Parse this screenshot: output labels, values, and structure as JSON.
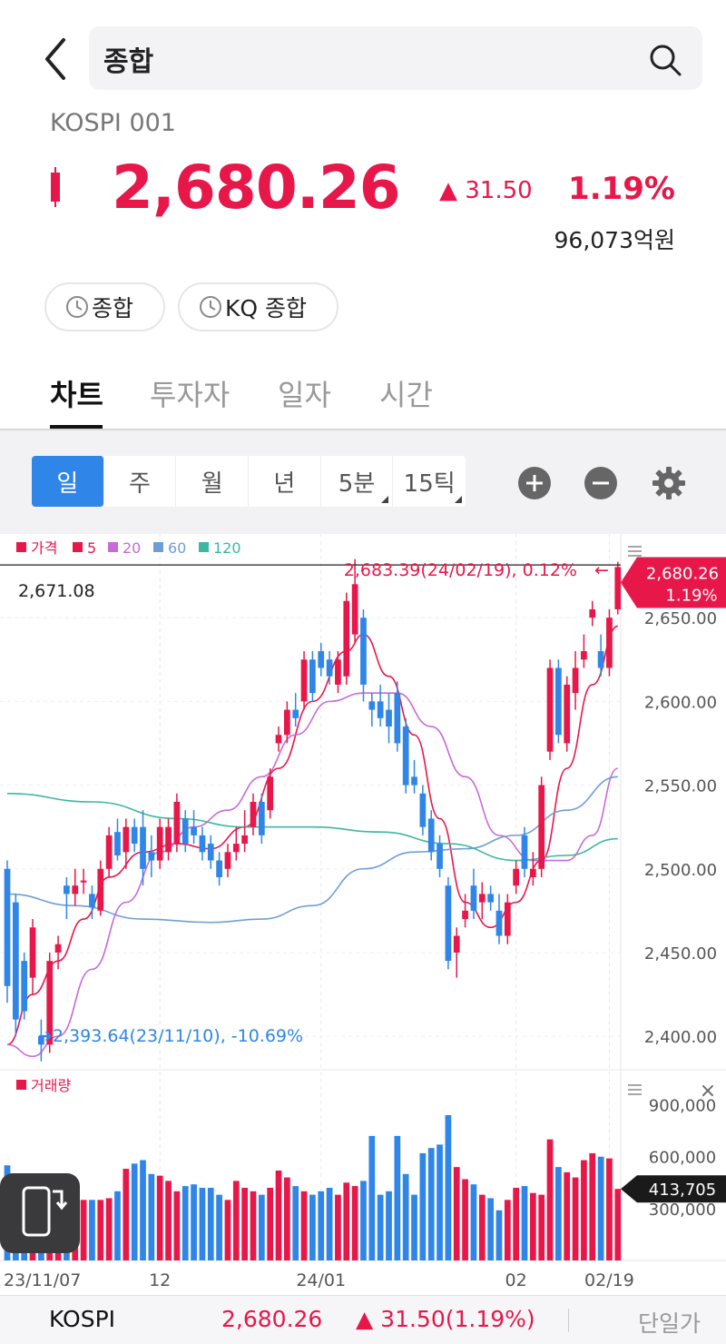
{
  "search": {
    "query": "종합"
  },
  "quote": {
    "ticker": "KOSPI 001",
    "price": "2,680.26",
    "change_abs": "▲ 31.50",
    "change_pct": "1.19%",
    "turnover": "96,073억원"
  },
  "chips": [
    {
      "label": "종합"
    },
    {
      "label": "KQ 종합"
    }
  ],
  "tabs": [
    {
      "label": "차트",
      "active": true
    },
    {
      "label": "투자자",
      "active": false
    },
    {
      "label": "일자",
      "active": false
    },
    {
      "label": "시간",
      "active": false
    }
  ],
  "periods": [
    {
      "label": "일",
      "active": true
    },
    {
      "label": "주",
      "active": false
    },
    {
      "label": "월",
      "active": false
    },
    {
      "label": "년",
      "active": false
    },
    {
      "label": "5분",
      "active": false
    },
    {
      "label": "15틱",
      "active": false
    }
  ],
  "colors": {
    "up": "#e8174a",
    "down": "#2f86e8",
    "ma5": "#e8174a",
    "ma20": "#c86ad8",
    "ma60": "#6f9ed6",
    "ma120": "#3db8a0"
  },
  "chart_data": {
    "type": "candlestick",
    "legend": [
      {
        "name": "가격",
        "color": "#e8174a"
      },
      {
        "name": "5",
        "color": "#e8174a"
      },
      {
        "name": "20",
        "color": "#c86ad8"
      },
      {
        "name": "60",
        "color": "#6f9ed6"
      },
      {
        "name": "120",
        "color": "#3db8a0"
      }
    ],
    "ylim": [
      2380,
      2700
    ],
    "y_ticks": [
      "2,650.00",
      "2,600.00",
      "2,550.00",
      "2,500.00",
      "2,450.00",
      "2,400.00"
    ],
    "y_tick_values": [
      2650,
      2600,
      2550,
      2500,
      2450,
      2400
    ],
    "x_labels": [
      {
        "label": "23/11/07",
        "index": 0
      },
      {
        "label": "12",
        "index": 18
      },
      {
        "label": "24/01",
        "index": 37
      },
      {
        "label": "02",
        "index": 60
      },
      {
        "label": "02/19",
        "index": 71
      }
    ],
    "crosshair_value": "2,671.08",
    "crosshair_price": 2681.5,
    "max_annotation": "2,683.39(24/02/19), 0.12%",
    "min_annotation": "➔2,393.64(23/11/10), -10.69%",
    "current_price_label": "2,680.26",
    "current_pct_label": "1.19%",
    "candles": [
      {
        "o": 2500,
        "h": 2505,
        "l": 2420,
        "c": 2430
      },
      {
        "o": 2480,
        "h": 2485,
        "l": 2400,
        "c": 2410
      },
      {
        "o": 2445,
        "h": 2450,
        "l": 2410,
        "c": 2415
      },
      {
        "o": 2435,
        "h": 2470,
        "l": 2425,
        "c": 2465
      },
      {
        "o": 2400,
        "h": 2410,
        "l": 2385,
        "c": 2395
      },
      {
        "o": 2395,
        "h": 2450,
        "l": 2390,
        "c": 2445
      },
      {
        "o": 2450,
        "h": 2460,
        "l": 2440,
        "c": 2455
      },
      {
        "o": 2490,
        "h": 2495,
        "l": 2470,
        "c": 2485
      },
      {
        "o": 2485,
        "h": 2500,
        "l": 2478,
        "c": 2490
      },
      {
        "o": 2492,
        "h": 2500,
        "l": 2485,
        "c": 2493
      },
      {
        "o": 2485,
        "h": 2490,
        "l": 2470,
        "c": 2477
      },
      {
        "o": 2475,
        "h": 2505,
        "l": 2472,
        "c": 2500
      },
      {
        "o": 2500,
        "h": 2525,
        "l": 2495,
        "c": 2520
      },
      {
        "o": 2522,
        "h": 2530,
        "l": 2505,
        "c": 2508
      },
      {
        "o": 2510,
        "h": 2530,
        "l": 2500,
        "c": 2525
      },
      {
        "o": 2525,
        "h": 2530,
        "l": 2510,
        "c": 2515
      },
      {
        "o": 2525,
        "h": 2535,
        "l": 2490,
        "c": 2500
      },
      {
        "o": 2510,
        "h": 2520,
        "l": 2495,
        "c": 2505
      },
      {
        "o": 2505,
        "h": 2530,
        "l": 2500,
        "c": 2525
      },
      {
        "o": 2510,
        "h": 2530,
        "l": 2505,
        "c": 2525
      },
      {
        "o": 2515,
        "h": 2545,
        "l": 2510,
        "c": 2540
      },
      {
        "o": 2530,
        "h": 2535,
        "l": 2510,
        "c": 2515
      },
      {
        "o": 2525,
        "h": 2535,
        "l": 2515,
        "c": 2520
      },
      {
        "o": 2520,
        "h": 2525,
        "l": 2505,
        "c": 2510
      },
      {
        "o": 2515,
        "h": 2520,
        "l": 2500,
        "c": 2505
      },
      {
        "o": 2505,
        "h": 2510,
        "l": 2490,
        "c": 2495
      },
      {
        "o": 2500,
        "h": 2515,
        "l": 2495,
        "c": 2510
      },
      {
        "o": 2510,
        "h": 2525,
        "l": 2505,
        "c": 2515
      },
      {
        "o": 2515,
        "h": 2535,
        "l": 2510,
        "c": 2520
      },
      {
        "o": 2525,
        "h": 2545,
        "l": 2520,
        "c": 2540
      },
      {
        "o": 2540,
        "h": 2545,
        "l": 2515,
        "c": 2520
      },
      {
        "o": 2535,
        "h": 2560,
        "l": 2530,
        "c": 2555
      },
      {
        "o": 2575,
        "h": 2585,
        "l": 2570,
        "c": 2580
      },
      {
        "o": 2580,
        "h": 2600,
        "l": 2575,
        "c": 2595
      },
      {
        "o": 2595,
        "h": 2605,
        "l": 2585,
        "c": 2590
      },
      {
        "o": 2600,
        "h": 2630,
        "l": 2595,
        "c": 2625
      },
      {
        "o": 2625,
        "h": 2630,
        "l": 2600,
        "c": 2605
      },
      {
        "o": 2630,
        "h": 2635,
        "l": 2615,
        "c": 2620
      },
      {
        "o": 2625,
        "h": 2630,
        "l": 2610,
        "c": 2615
      },
      {
        "o": 2610,
        "h": 2630,
        "l": 2605,
        "c": 2625
      },
      {
        "o": 2615,
        "h": 2665,
        "l": 2610,
        "c": 2660
      },
      {
        "o": 2640,
        "h": 2685,
        "l": 2635,
        "c": 2670
      },
      {
        "o": 2650,
        "h": 2655,
        "l": 2600,
        "c": 2610
      },
      {
        "o": 2600,
        "h": 2605,
        "l": 2585,
        "c": 2595
      },
      {
        "o": 2600,
        "h": 2610,
        "l": 2585,
        "c": 2590
      },
      {
        "o": 2595,
        "h": 2605,
        "l": 2575,
        "c": 2585
      },
      {
        "o": 2605,
        "h": 2612,
        "l": 2570,
        "c": 2575
      },
      {
        "o": 2585,
        "h": 2590,
        "l": 2545,
        "c": 2550
      },
      {
        "o": 2555,
        "h": 2565,
        "l": 2545,
        "c": 2550
      },
      {
        "o": 2545,
        "h": 2550,
        "l": 2520,
        "c": 2525
      },
      {
        "o": 2530,
        "h": 2535,
        "l": 2505,
        "c": 2510
      },
      {
        "o": 2515,
        "h": 2520,
        "l": 2495,
        "c": 2500
      },
      {
        "o": 2490,
        "h": 2495,
        "l": 2440,
        "c": 2445
      },
      {
        "o": 2450,
        "h": 2465,
        "l": 2435,
        "c": 2460
      },
      {
        "o": 2470,
        "h": 2485,
        "l": 2465,
        "c": 2475
      },
      {
        "o": 2490,
        "h": 2500,
        "l": 2470,
        "c": 2475
      },
      {
        "o": 2480,
        "h": 2492,
        "l": 2470,
        "c": 2485
      },
      {
        "o": 2485,
        "h": 2490,
        "l": 2475,
        "c": 2480
      },
      {
        "o": 2475,
        "h": 2485,
        "l": 2455,
        "c": 2460
      },
      {
        "o": 2460,
        "h": 2485,
        "l": 2455,
        "c": 2480
      },
      {
        "o": 2490,
        "h": 2505,
        "l": 2485,
        "c": 2500
      },
      {
        "o": 2520,
        "h": 2525,
        "l": 2495,
        "c": 2500
      },
      {
        "o": 2495,
        "h": 2510,
        "l": 2490,
        "c": 2500
      },
      {
        "o": 2500,
        "h": 2555,
        "l": 2495,
        "c": 2550
      },
      {
        "o": 2570,
        "h": 2625,
        "l": 2565,
        "c": 2620
      },
      {
        "o": 2620,
        "h": 2625,
        "l": 2575,
        "c": 2580
      },
      {
        "o": 2575,
        "h": 2615,
        "l": 2570,
        "c": 2610
      },
      {
        "o": 2605,
        "h": 2630,
        "l": 2595,
        "c": 2620
      },
      {
        "o": 2625,
        "h": 2640,
        "l": 2620,
        "c": 2630
      },
      {
        "o": 2650,
        "h": 2660,
        "l": 2645,
        "c": 2655
      },
      {
        "o": 2630,
        "h": 2640,
        "l": 2615,
        "c": 2620
      },
      {
        "o": 2620,
        "h": 2655,
        "l": 2615,
        "c": 2650
      },
      {
        "o": 2655,
        "h": 2683.39,
        "l": 2652,
        "c": 2680.26
      }
    ],
    "ma_anchors": {
      "ma5": [
        [
          0,
          2395
        ],
        [
          3,
          2425
        ],
        [
          6,
          2445
        ],
        [
          9,
          2470
        ],
        [
          12,
          2495
        ],
        [
          16,
          2510
        ],
        [
          20,
          2515
        ],
        [
          24,
          2512
        ],
        [
          28,
          2525
        ],
        [
          32,
          2560
        ],
        [
          36,
          2600
        ],
        [
          40,
          2630
        ],
        [
          42,
          2640
        ],
        [
          45,
          2615
        ],
        [
          48,
          2580
        ],
        [
          51,
          2530
        ],
        [
          54,
          2480
        ],
        [
          57,
          2465
        ],
        [
          60,
          2480
        ],
        [
          63,
          2505
        ],
        [
          66,
          2560
        ],
        [
          69,
          2610
        ],
        [
          72,
          2645
        ]
      ],
      "ma20": [
        [
          0,
          2395
        ],
        [
          3,
          2388
        ],
        [
          6,
          2400
        ],
        [
          10,
          2440
        ],
        [
          14,
          2480
        ],
        [
          18,
          2510
        ],
        [
          22,
          2525
        ],
        [
          26,
          2535
        ],
        [
          30,
          2555
        ],
        [
          34,
          2580
        ],
        [
          38,
          2600
        ],
        [
          42,
          2605
        ],
        [
          46,
          2605
        ],
        [
          50,
          2585
        ],
        [
          54,
          2555
        ],
        [
          58,
          2520
        ],
        [
          62,
          2505
        ],
        [
          66,
          2505
        ],
        [
          69,
          2520
        ],
        [
          72,
          2560
        ]
      ],
      "ma60": [
        [
          0,
          2485
        ],
        [
          8,
          2478
        ],
        [
          16,
          2470
        ],
        [
          24,
          2468
        ],
        [
          30,
          2470
        ],
        [
          36,
          2478
        ],
        [
          42,
          2500
        ],
        [
          48,
          2510
        ],
        [
          54,
          2512
        ],
        [
          60,
          2520
        ],
        [
          66,
          2535
        ],
        [
          72,
          2555
        ]
      ],
      "ma120": [
        [
          0,
          2545
        ],
        [
          10,
          2540
        ],
        [
          20,
          2530
        ],
        [
          28,
          2525
        ],
        [
          36,
          2525
        ],
        [
          44,
          2522
        ],
        [
          52,
          2515
        ],
        [
          60,
          2505
        ],
        [
          66,
          2508
        ],
        [
          72,
          2518
        ]
      ]
    },
    "volume": {
      "legend": "거래량",
      "ylim": [
        0,
        1050000
      ],
      "y_ticks": [
        "900,000",
        "600,000",
        "300,000"
      ],
      "y_tick_values": [
        900000,
        600000,
        300000
      ],
      "current_label": "413,705",
      "current_value": 413705,
      "values": [
        550000,
        470000,
        350000,
        360000,
        400000,
        380000,
        380000,
        370000,
        420000,
        350000,
        350000,
        350000,
        360000,
        400000,
        530000,
        560000,
        580000,
        500000,
        490000,
        460000,
        400000,
        430000,
        440000,
        420000,
        420000,
        380000,
        350000,
        460000,
        420000,
        400000,
        380000,
        420000,
        520000,
        480000,
        430000,
        400000,
        380000,
        400000,
        420000,
        380000,
        450000,
        430000,
        460000,
        720000,
        380000,
        400000,
        720000,
        500000,
        380000,
        620000,
        650000,
        670000,
        840000,
        540000,
        470000,
        440000,
        380000,
        360000,
        290000,
        350000,
        420000,
        430000,
        390000,
        380000,
        700000,
        540000,
        510000,
        480000,
        580000,
        620000,
        600000,
        590000,
        413705
      ]
    }
  },
  "bottom_bar": {
    "name": "KOSPI",
    "price": "2,680.26",
    "change": "▲ 31.50(1.19%)",
    "mode": "단일가"
  }
}
